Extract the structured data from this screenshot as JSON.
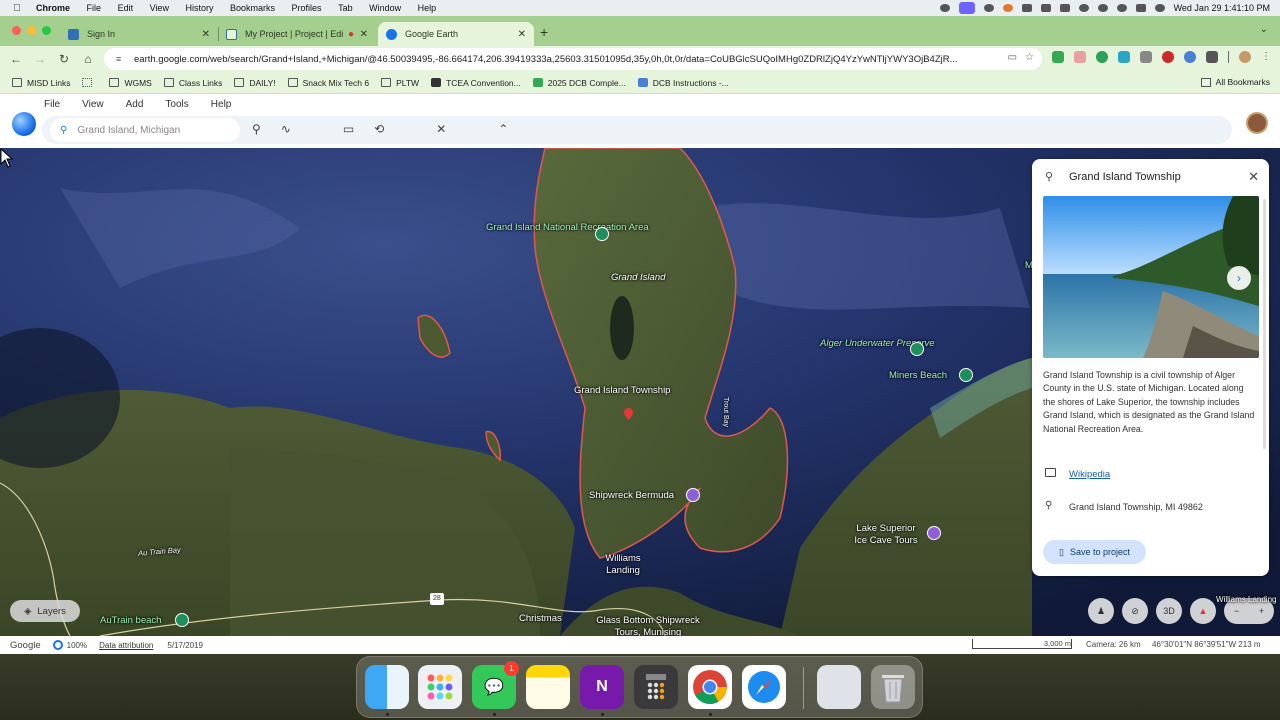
{
  "macbar": {
    "app_name": "Chrome",
    "menus": [
      "File",
      "Edit",
      "View",
      "History",
      "Bookmarks",
      "Profiles",
      "Tab",
      "Window",
      "Help"
    ],
    "clock": "Wed Jan 29  1:41:10 PM"
  },
  "tabs": [
    {
      "label": "Sign In",
      "favicon": "gradebook-icon",
      "active": false
    },
    {
      "label": "My Project | Project | Edi",
      "favicon": "project-icon",
      "active": false
    },
    {
      "label": "Google Earth",
      "favicon": "google-earth-icon",
      "active": true
    }
  ],
  "url": "earth.google.com/web/search/Grand+Island,+Michigan/@46.50039495,-86.664174,206.39419333a,25603.31501095d,35y,0h,0t,0r/data=CoUBGlcSUQoIMHg0ZDRlZjQ4YzYwNTljYWY3OjB4ZjR...",
  "bookmarks": [
    "MISD Links",
    "WGMS",
    "Class Links",
    "DAILY!",
    "Snack Mix Tech 6",
    "PLTW",
    "TCEA Convention...",
    "2025 DCB Comple...",
    "DCB Instructions -..."
  ],
  "all_bookmarks_label": "All Bookmarks",
  "earth_menu": [
    "File",
    "View",
    "Add",
    "Tools",
    "Help"
  ],
  "search": {
    "value": "Grand Island, Michigan"
  },
  "map_labels": {
    "recreation_area": "Grand Island National Recreation Area",
    "grand_island": "Grand Island",
    "township": "Grand Island Township",
    "trout_bay": "Trout Bay",
    "alger_preserve": "Alger Underwater Preserve",
    "miners_beach": "Miners Beach",
    "shipwreck": "Shipwreck Bermuda",
    "ice_cave": "Lake Superior Ice Cave Tours",
    "williams_landing": "Williams Landing",
    "au_train_bay": "Au Train Bay",
    "autrain_beach": "AuTrain beach",
    "christmas": "Christmas",
    "glass_bottom": "Glass Bottom Shipwreck Tours, Munising",
    "route": "28",
    "edge_m": "M",
    "williams_edge": "Williams Landing"
  },
  "layers_label": "Layers",
  "map_controls": {
    "mode": "3D"
  },
  "panel": {
    "title": "Grand Island Township",
    "description": "Grand Island Township is a civil township of Alger County in the U.S. state of Michigan. Located along the shores of Lake Superior, the township includes Grand Island, which is designated as the Grand Island National Recreation Area.",
    "wiki_label": "Wikipedia",
    "address": "Grand Island Township, MI 49862",
    "save_label": "Save to project"
  },
  "status": {
    "brand": "Google",
    "percent": "100%",
    "attribution": "Data attribution",
    "date": "5/17/2019",
    "scale": "3,000 m",
    "camera": "Camera: 26 km",
    "coords": "46°30'01\"N 86°39'51\"W  213 m"
  },
  "dock": {
    "messages_badge": "1"
  },
  "colors": {
    "tab_strip": "#a4cf8f",
    "toolbar": "#e6f4dc",
    "accent": "#1a73e8",
    "boundary": "#e0584d"
  }
}
